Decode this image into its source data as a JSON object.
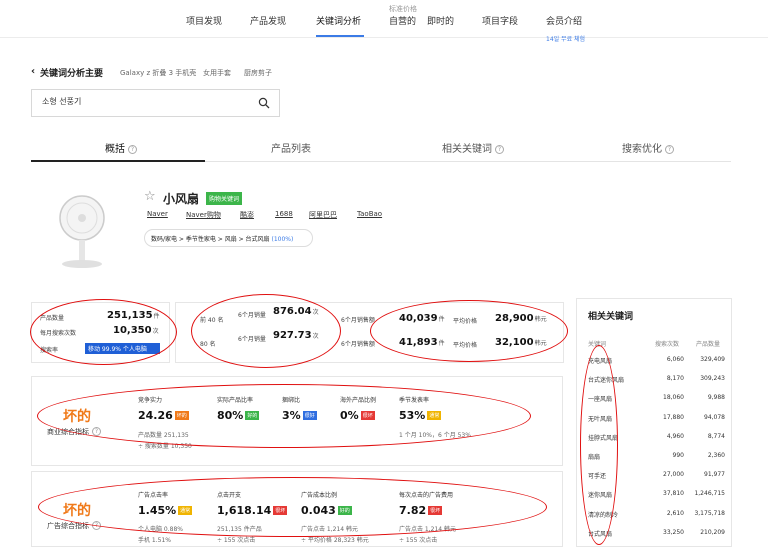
{
  "nav": {
    "items": [
      "项目发现",
      "产品发现",
      "关键词分析",
      "自营的",
      "即时的",
      "项目字段",
      "会员介绍"
    ],
    "hint": "标准价格",
    "trial": "14일 무료 체험"
  },
  "breadcrumb": {
    "back": "‹",
    "title": "关键词分析主要",
    "links": [
      "Galaxy z 折叠 3 手机壳",
      "女用手套",
      "厨房剪子"
    ]
  },
  "search": {
    "value": "소형 선풍기"
  },
  "tabs": [
    "概括",
    "产品列表",
    "相关关键词",
    "搜索优化"
  ],
  "product": {
    "name": "小风扇",
    "badge": "购物关键词",
    "links": [
      "Naver",
      "Naver购物",
      "酷澎",
      "1688",
      "阿里巴巴",
      "TaoBao"
    ],
    "category": "数码/家电 > 季节性家电 > 风扇 > 台式风扇",
    "category_pct": "(100%)"
  },
  "stats": {
    "product_count_label": "产品数量",
    "product_count": "251,135",
    "product_count_unit": "件",
    "monthly_search_label": "每月搜索次数",
    "monthly_search": "10,350",
    "monthly_search_unit": "次",
    "search_ratio_label": "搜索率",
    "search_ratio_bar": "移动 99.9% 个人电脑"
  },
  "sales": {
    "top40_label": "前 40 名",
    "top80_label": "80 名",
    "m6_label": "6个月销量",
    "m6_value_1": "876.04",
    "m6_value_2": "927.73",
    "m6_unit": "次"
  },
  "stats_mid": {
    "label_1": "6个月销售额",
    "label_2": "6个月销售额"
  },
  "price": {
    "row1_value": "40,039",
    "row1_unit": "件",
    "avg_label": "平均价格",
    "avg_value": "28,900",
    "avg_unit": "韩元",
    "row2_value": "41,893",
    "row2_unit": "件",
    "avg2_label": "平均价格",
    "avg2_value": "32,100",
    "avg2_unit": "韩元"
  },
  "market": {
    "rating": "坏的",
    "title": "商业综合指标",
    "metrics": [
      {
        "label": "竞争实力",
        "value": "24.26",
        "tag": "坏的",
        "tagclass": "t-or"
      },
      {
        "label": "实际产品比率",
        "value": "80%",
        "tag": "好的",
        "tagclass": "t-gr"
      },
      {
        "label": "捆绑比",
        "value": "3%",
        "tag": "很好",
        "tagclass": "t-bl"
      },
      {
        "label": "海外产品比例",
        "value": "0%",
        "tag": "很坏",
        "tagclass": "t-rd"
      },
      {
        "label": "季节发表率",
        "value": "53%",
        "tag": "通常",
        "tagclass": "t-yl"
      }
    ],
    "sub1": "产品数量 251,135",
    "sub2": "÷ 搜索数量 10,350",
    "sub3": "1 个月 10%，6 个月 53%"
  },
  "ads": {
    "rating": "坏的",
    "title": "广告综合指标",
    "metrics": [
      {
        "label": "广告点击率",
        "value": "1.45%",
        "tag": "通常",
        "tagclass": "t-yl"
      },
      {
        "label": "点击开支",
        "value": "1,618.14",
        "tag": "很坏",
        "tagclass": "t-rd"
      },
      {
        "label": "广告成本比例",
        "value": "0.043",
        "tag": "好的",
        "tagclass": "t-gr"
      },
      {
        "label": "每次点击的广告费用",
        "value": "7.82",
        "tag": "很坏",
        "tagclass": "t-rd"
      }
    ],
    "sub1": "个人电脑 0.88%",
    "sub1b": "手机 1.51%",
    "sub2": "251,135 件产品",
    "sub2b": "÷ 155 次点击",
    "sub3": "广告点击 1,214 韩元",
    "sub3b": "÷ 平均价格 28,323 韩元",
    "sub4": "广告点击 1,214 韩元",
    "sub4b": "÷ 155 次点击"
  },
  "ranking": {
    "title": "相关关键词",
    "headers": [
      "关键词",
      "搜索次数",
      "产品数量"
    ],
    "rows": [
      {
        "kw": "充电风扇",
        "a": "6,060",
        "b": "329,409"
      },
      {
        "kw": "台式迷你风扇",
        "a": "8,170",
        "b": "309,243"
      },
      {
        "kw": "一座风扇",
        "a": "18,060",
        "b": "9,988"
      },
      {
        "kw": "无叶风扇",
        "a": "17,880",
        "b": "94,078"
      },
      {
        "kw": "挂脖式风扇",
        "a": "4,960",
        "b": "8,774"
      },
      {
        "kw": "扇扇",
        "a": "990",
        "b": "2,360"
      },
      {
        "kw": "可手还",
        "a": "27,000",
        "b": "91,977"
      },
      {
        "kw": "迷你风扇",
        "a": "37,810",
        "b": "1,246,715"
      },
      {
        "kw": "清凉的制冷",
        "a": "2,610",
        "b": "3,175,718"
      },
      {
        "kw": "台式风扇",
        "a": "33,250",
        "b": "210,209"
      }
    ]
  },
  "colors": {
    "accent": "#3b7be6",
    "annotation": "#e01010",
    "bad": "#f07a1a"
  }
}
